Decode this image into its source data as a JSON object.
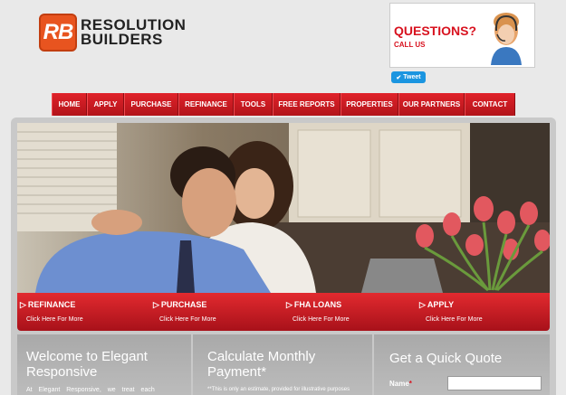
{
  "logo": {
    "badge": "RB",
    "line1": "RESOLUTION",
    "line2": "BUILDERS"
  },
  "contact": {
    "title": "QUESTIONS?",
    "subtitle": "CALL US"
  },
  "tweet": {
    "label": "Tweet"
  },
  "nav": [
    "HOME",
    "APPLY",
    "PURCHASE",
    "REFINANCE",
    "TOOLS",
    "FREE REPORTS",
    "PROPERTIES",
    "OUR PARTNERS",
    "CONTACT"
  ],
  "hero_links": [
    {
      "title": "REFINANCE",
      "sub": "Click Here For More"
    },
    {
      "title": "PURCHASE",
      "sub": "Click Here For More"
    },
    {
      "title": "FHA LOANS",
      "sub": "Click Here For More"
    },
    {
      "title": "APPLY",
      "sub": "Click Here For More"
    }
  ],
  "columns": {
    "welcome": {
      "title_1": "Welcome to Elegant",
      "title_2": "Responsive",
      "text": "At Elegant Responsive, we treat each"
    },
    "calc": {
      "title_1": "Calculate Monthly",
      "title_2": "Payment*",
      "text": "**This is only an estimate, provided for illustrative purposes"
    },
    "quote": {
      "title": "Get a Quick Quote",
      "name_label": "Name",
      "required_mark": "*"
    }
  },
  "colors": {
    "brand_red": "#d8121f",
    "logo_orange": "#e8541f",
    "tweet_blue": "#1b95e0"
  }
}
